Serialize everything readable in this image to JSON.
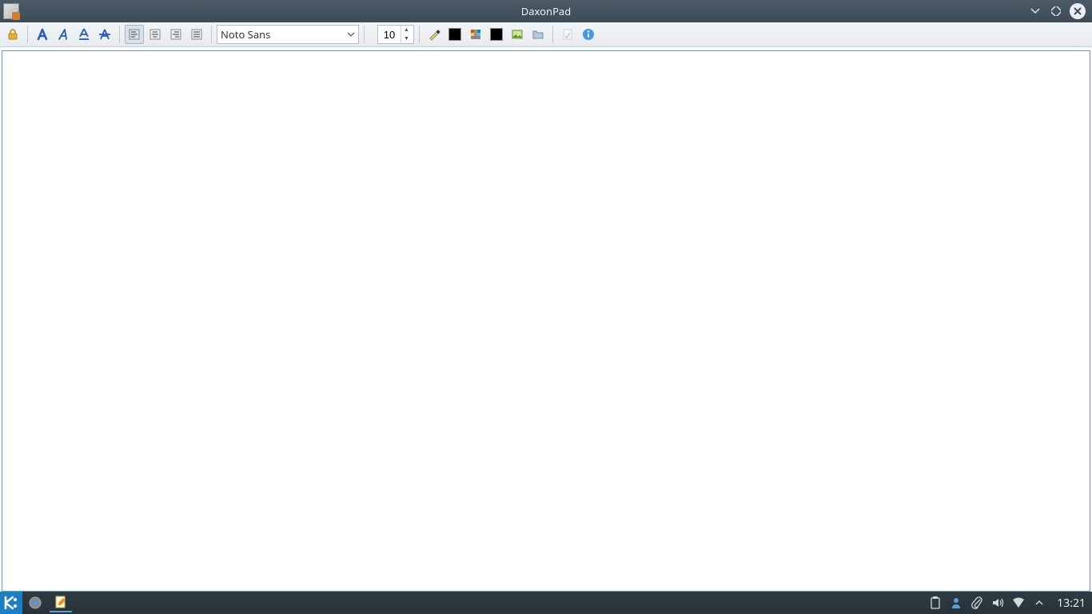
{
  "window": {
    "title": "DaxonPad"
  },
  "toolbar": {
    "font_name": "Noto Sans",
    "font_size": "10"
  },
  "taskbar": {
    "clock": "13:21"
  }
}
